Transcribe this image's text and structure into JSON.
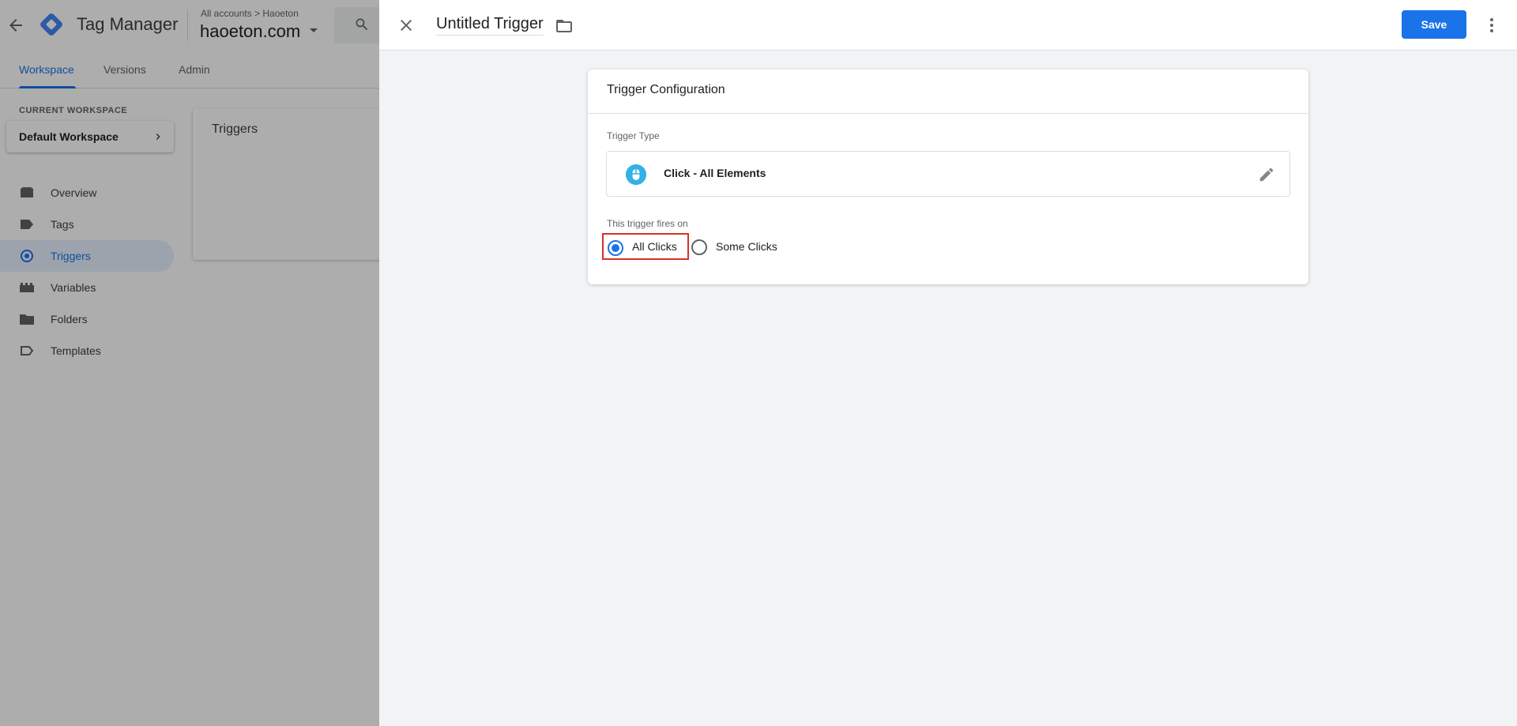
{
  "app": {
    "product_name": "Tag Manager",
    "breadcrumb": "All accounts > Haoeton",
    "account_name": "haoeton.com"
  },
  "subnav": {
    "tabs": [
      {
        "label": "Workspace",
        "active": true
      },
      {
        "label": "Versions",
        "active": false
      },
      {
        "label": "Admin",
        "active": false
      }
    ]
  },
  "sidebar": {
    "workspace_label": "CURRENT WORKSPACE",
    "workspace_name": "Default Workspace",
    "items": [
      {
        "label": "Overview",
        "icon": "overview-icon",
        "active": false
      },
      {
        "label": "Tags",
        "icon": "tag-icon",
        "active": false
      },
      {
        "label": "Triggers",
        "icon": "trigger-icon",
        "active": true
      },
      {
        "label": "Variables",
        "icon": "variables-icon",
        "active": false
      },
      {
        "label": "Folders",
        "icon": "folder-icon",
        "active": false
      },
      {
        "label": "Templates",
        "icon": "templates-icon",
        "active": false
      }
    ]
  },
  "main": {
    "card_title": "Triggers"
  },
  "panel": {
    "title": "Untitled Trigger",
    "save_label": "Save",
    "config": {
      "title": "Trigger Configuration",
      "trigger_type_label": "Trigger Type",
      "trigger_type_name": "Click - All Elements",
      "fires_on_label": "This trigger fires on",
      "options": [
        {
          "label": "All Clicks",
          "checked": true
        },
        {
          "label": "Some Clicks",
          "checked": false
        }
      ]
    }
  },
  "colors": {
    "accent": "#1a73e8",
    "highlight_border": "#d93025",
    "trigger_icon_bg": "#33b1e6",
    "panel_bg": "#f1f3f4"
  }
}
